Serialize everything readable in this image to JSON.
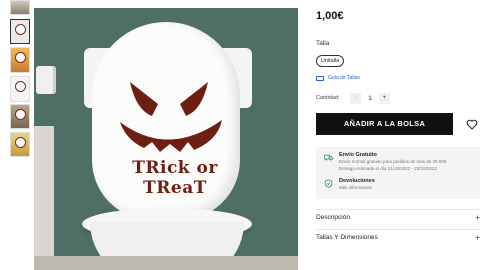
{
  "product": {
    "price": "1,00€",
    "size_label": "Talla",
    "size_option": "Unitalla",
    "size_guide": "Guía de Tallas",
    "quantity_label": "Cantidad:",
    "quantity_minus": "-",
    "quantity_value": "1",
    "quantity_plus": "+",
    "add_to_bag": "AÑADIR A LA BOLSA"
  },
  "hero": {
    "sticker_text": "TRick or TReaT"
  },
  "shipping": {
    "title": "Envío Gratuito",
    "line1": "Envío normal gratuito para pedidos de más de 29,00€",
    "line2": "Entrega estimada el día 21/10/2022 - 23/10/2022"
  },
  "returns": {
    "title": "Devoluciones",
    "sub": "Más información"
  },
  "accordion": [
    {
      "label": "Descripción",
      "icon": "+"
    },
    {
      "label": "Tallas Y Dimensiones",
      "icon": "+"
    }
  ],
  "icons": {
    "favorite": "heart-outline-icon",
    "shipping": "truck-icon",
    "returns": "shield-check-icon",
    "guide": "ruler-icon"
  },
  "colors": {
    "accent_link": "#2a5bd7",
    "button_bg": "#111111",
    "sticker": "#6e1f13",
    "shipping_icon": "#2e8b57"
  }
}
